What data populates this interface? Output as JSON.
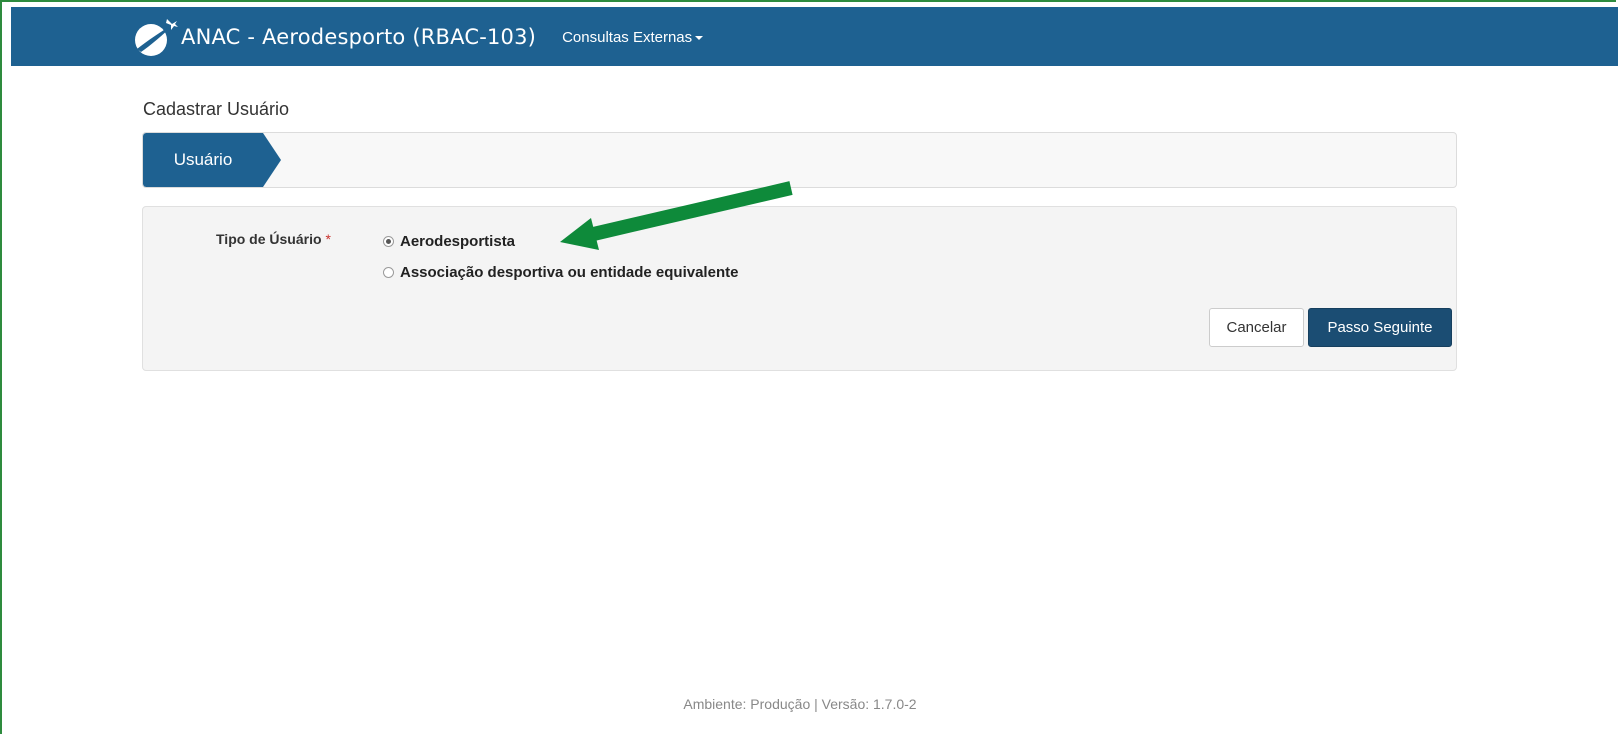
{
  "navbar": {
    "title": "ANAC - Aerodesporto (RBAC-103)",
    "menu_label": "Consultas Externas",
    "logo_icon": "anac-plane-logo-icon",
    "background_color": "#1e6191"
  },
  "page": {
    "title": "Cadastrar Usuário"
  },
  "wizard": {
    "steps": [
      {
        "label": "Usuário",
        "active": true
      }
    ]
  },
  "form": {
    "field_label": "Tipo de Úsuário",
    "required_marker": "*",
    "options": [
      {
        "label": "Aerodesportista",
        "checked": true
      },
      {
        "label": "Associação desportiva ou entidade equivalente",
        "checked": false
      }
    ],
    "cancel_label": "Cancelar",
    "next_label": "Passo Seguinte"
  },
  "annotation": {
    "arrow_color": "#0e8a3a",
    "icon": "green-arrow-icon"
  },
  "footer": {
    "text": "Ambiente: Produção | Versão: 1.7.0-2"
  }
}
